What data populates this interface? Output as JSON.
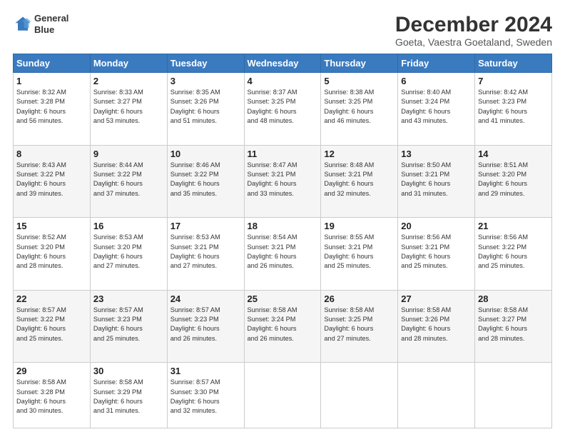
{
  "header": {
    "logo_line1": "General",
    "logo_line2": "Blue",
    "title": "December 2024",
    "subtitle": "Goeta, Vaestra Goetaland, Sweden"
  },
  "days_of_week": [
    "Sunday",
    "Monday",
    "Tuesday",
    "Wednesday",
    "Thursday",
    "Friday",
    "Saturday"
  ],
  "weeks": [
    [
      {
        "day": "1",
        "info": "Sunrise: 8:32 AM\nSunset: 3:28 PM\nDaylight: 6 hours\nand 56 minutes."
      },
      {
        "day": "2",
        "info": "Sunrise: 8:33 AM\nSunset: 3:27 PM\nDaylight: 6 hours\nand 53 minutes."
      },
      {
        "day": "3",
        "info": "Sunrise: 8:35 AM\nSunset: 3:26 PM\nDaylight: 6 hours\nand 51 minutes."
      },
      {
        "day": "4",
        "info": "Sunrise: 8:37 AM\nSunset: 3:25 PM\nDaylight: 6 hours\nand 48 minutes."
      },
      {
        "day": "5",
        "info": "Sunrise: 8:38 AM\nSunset: 3:25 PM\nDaylight: 6 hours\nand 46 minutes."
      },
      {
        "day": "6",
        "info": "Sunrise: 8:40 AM\nSunset: 3:24 PM\nDaylight: 6 hours\nand 43 minutes."
      },
      {
        "day": "7",
        "info": "Sunrise: 8:42 AM\nSunset: 3:23 PM\nDaylight: 6 hours\nand 41 minutes."
      }
    ],
    [
      {
        "day": "8",
        "info": "Sunrise: 8:43 AM\nSunset: 3:22 PM\nDaylight: 6 hours\nand 39 minutes."
      },
      {
        "day": "9",
        "info": "Sunrise: 8:44 AM\nSunset: 3:22 PM\nDaylight: 6 hours\nand 37 minutes."
      },
      {
        "day": "10",
        "info": "Sunrise: 8:46 AM\nSunset: 3:22 PM\nDaylight: 6 hours\nand 35 minutes."
      },
      {
        "day": "11",
        "info": "Sunrise: 8:47 AM\nSunset: 3:21 PM\nDaylight: 6 hours\nand 33 minutes."
      },
      {
        "day": "12",
        "info": "Sunrise: 8:48 AM\nSunset: 3:21 PM\nDaylight: 6 hours\nand 32 minutes."
      },
      {
        "day": "13",
        "info": "Sunrise: 8:50 AM\nSunset: 3:21 PM\nDaylight: 6 hours\nand 31 minutes."
      },
      {
        "day": "14",
        "info": "Sunrise: 8:51 AM\nSunset: 3:20 PM\nDaylight: 6 hours\nand 29 minutes."
      }
    ],
    [
      {
        "day": "15",
        "info": "Sunrise: 8:52 AM\nSunset: 3:20 PM\nDaylight: 6 hours\nand 28 minutes."
      },
      {
        "day": "16",
        "info": "Sunrise: 8:53 AM\nSunset: 3:20 PM\nDaylight: 6 hours\nand 27 minutes."
      },
      {
        "day": "17",
        "info": "Sunrise: 8:53 AM\nSunset: 3:21 PM\nDaylight: 6 hours\nand 27 minutes."
      },
      {
        "day": "18",
        "info": "Sunrise: 8:54 AM\nSunset: 3:21 PM\nDaylight: 6 hours\nand 26 minutes."
      },
      {
        "day": "19",
        "info": "Sunrise: 8:55 AM\nSunset: 3:21 PM\nDaylight: 6 hours\nand 25 minutes."
      },
      {
        "day": "20",
        "info": "Sunrise: 8:56 AM\nSunset: 3:21 PM\nDaylight: 6 hours\nand 25 minutes."
      },
      {
        "day": "21",
        "info": "Sunrise: 8:56 AM\nSunset: 3:22 PM\nDaylight: 6 hours\nand 25 minutes."
      }
    ],
    [
      {
        "day": "22",
        "info": "Sunrise: 8:57 AM\nSunset: 3:22 PM\nDaylight: 6 hours\nand 25 minutes."
      },
      {
        "day": "23",
        "info": "Sunrise: 8:57 AM\nSunset: 3:23 PM\nDaylight: 6 hours\nand 25 minutes."
      },
      {
        "day": "24",
        "info": "Sunrise: 8:57 AM\nSunset: 3:23 PM\nDaylight: 6 hours\nand 26 minutes."
      },
      {
        "day": "25",
        "info": "Sunrise: 8:58 AM\nSunset: 3:24 PM\nDaylight: 6 hours\nand 26 minutes."
      },
      {
        "day": "26",
        "info": "Sunrise: 8:58 AM\nSunset: 3:25 PM\nDaylight: 6 hours\nand 27 minutes."
      },
      {
        "day": "27",
        "info": "Sunrise: 8:58 AM\nSunset: 3:26 PM\nDaylight: 6 hours\nand 28 minutes."
      },
      {
        "day": "28",
        "info": "Sunrise: 8:58 AM\nSunset: 3:27 PM\nDaylight: 6 hours\nand 28 minutes."
      }
    ],
    [
      {
        "day": "29",
        "info": "Sunrise: 8:58 AM\nSunset: 3:28 PM\nDaylight: 6 hours\nand 30 minutes."
      },
      {
        "day": "30",
        "info": "Sunrise: 8:58 AM\nSunset: 3:29 PM\nDaylight: 6 hours\nand 31 minutes."
      },
      {
        "day": "31",
        "info": "Sunrise: 8:57 AM\nSunset: 3:30 PM\nDaylight: 6 hours\nand 32 minutes."
      },
      {
        "day": "",
        "info": ""
      },
      {
        "day": "",
        "info": ""
      },
      {
        "day": "",
        "info": ""
      },
      {
        "day": "",
        "info": ""
      }
    ]
  ]
}
